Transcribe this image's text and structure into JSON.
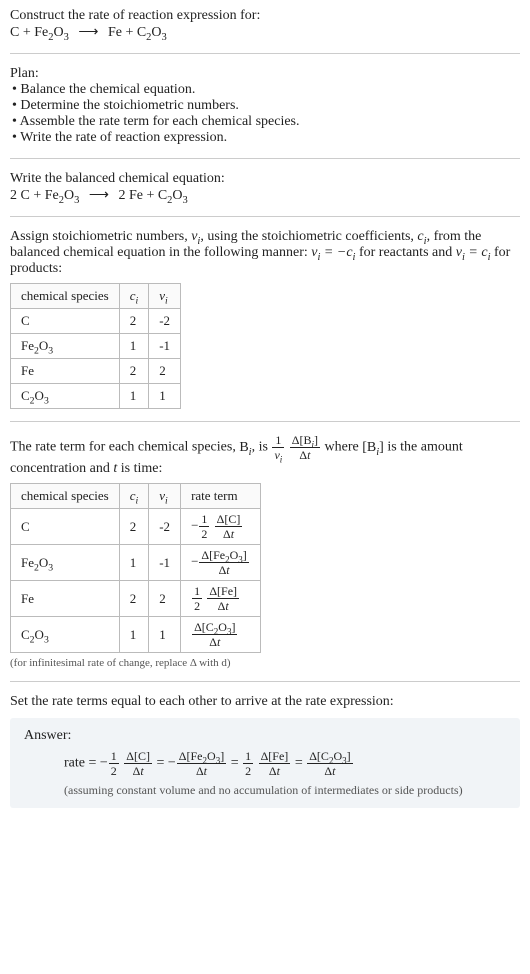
{
  "header": {
    "prompt": "Construct the rate of reaction expression for:"
  },
  "plan": {
    "title": "Plan:",
    "items": [
      "• Balance the chemical equation.",
      "• Determine the stoichiometric numbers.",
      "• Assemble the rate term for each chemical species.",
      "• Write the rate of reaction expression."
    ]
  },
  "balanced": {
    "title": "Write the balanced chemical equation:"
  },
  "assign": {
    "text_before": "Assign stoichiometric numbers, ",
    "text_mid1": ", using the stoichiometric coefficients, ",
    "text_mid2": ", from the balanced chemical equation in the following manner: ",
    "text_mid3": " for reactants and ",
    "text_mid4": " for products:"
  },
  "table1": {
    "headers": [
      "chemical species",
      "cᵢ",
      "νᵢ"
    ],
    "rows": [
      {
        "species_html": "C",
        "c": "2",
        "v": "-2"
      },
      {
        "species_html": "Fe2O3",
        "c": "1",
        "v": "-1"
      },
      {
        "species_html": "Fe",
        "c": "2",
        "v": "2"
      },
      {
        "species_html": "C2O3",
        "c": "1",
        "v": "1"
      }
    ]
  },
  "rate_term_intro": {
    "pre": "The rate term for each chemical species, ",
    "mid1": ", is ",
    "mid2": " where ",
    "mid3": " is the amount concentration and ",
    "mid4": " is time:"
  },
  "table2": {
    "headers": [
      "chemical species",
      "cᵢ",
      "νᵢ",
      "rate term"
    ]
  },
  "note": "(for infinitesimal rate of change, replace Δ with d)",
  "final": {
    "title": "Set the rate terms equal to each other to arrive at the rate expression:"
  },
  "answer": {
    "label": "Answer:",
    "note": "(assuming constant volume and no accumulation of intermediates or side products)"
  },
  "chart_data": {
    "type": "table",
    "unbalanced_equation": "C + Fe2O3 -> Fe + C2O3",
    "balanced_equation": "2 C + Fe2O3 -> 2 Fe + C2O3",
    "species": [
      {
        "name": "C",
        "c_i": 2,
        "nu_i": -2,
        "rate_term": "-(1/2) d[C]/dt"
      },
      {
        "name": "Fe2O3",
        "c_i": 1,
        "nu_i": -1,
        "rate_term": "- d[Fe2O3]/dt"
      },
      {
        "name": "Fe",
        "c_i": 2,
        "nu_i": 2,
        "rate_term": "(1/2) d[Fe]/dt"
      },
      {
        "name": "C2O3",
        "c_i": 1,
        "nu_i": 1,
        "rate_term": "d[C2O3]/dt"
      }
    ],
    "rate_expression": "rate = -(1/2) Δ[C]/Δt = - Δ[Fe2O3]/Δt = (1/2) Δ[Fe]/Δt = Δ[C2O3]/Δt"
  }
}
